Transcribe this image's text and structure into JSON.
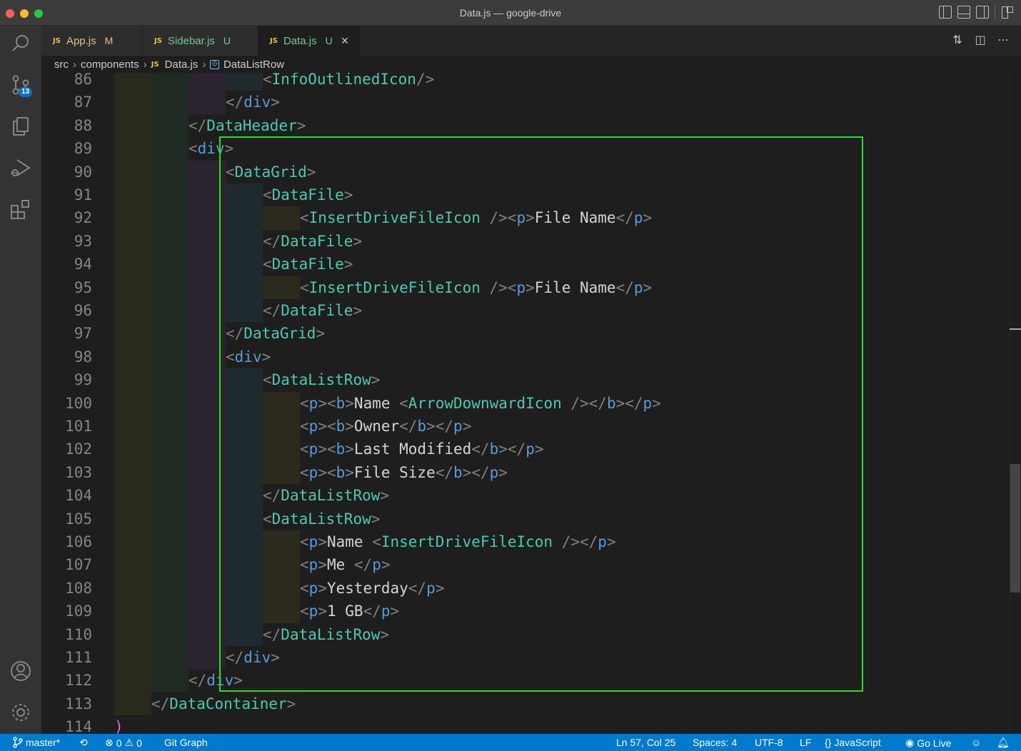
{
  "window": {
    "title": "Data.js — google-drive"
  },
  "activity_bar": {
    "items": [
      "search-icon",
      "source-control-icon",
      "explorer-icon",
      "run-debug-icon",
      "extensions-icon"
    ],
    "source_control_badge": "13",
    "bottom_items": [
      "accounts-icon",
      "settings-gear-icon"
    ]
  },
  "tabs": [
    {
      "lang": "JS",
      "label": "App.js",
      "status": "M"
    },
    {
      "lang": "JS",
      "label": "Sidebar.js",
      "status": "U"
    },
    {
      "lang": "JS",
      "label": "Data.js",
      "status": "U",
      "active": true
    }
  ],
  "tab_actions": [
    "compare-changes-icon",
    "split-editor-icon",
    "more-actions-icon"
  ],
  "breadcrumb": {
    "parts": [
      "src",
      "components"
    ],
    "file_lang": "JS",
    "file": "Data.js",
    "symbol": "DataListRow"
  },
  "editor": {
    "lines": [
      {
        "n": "86",
        "depth": 6,
        "tokens": [
          [
            "b",
            "<"
          ],
          [
            "tag",
            "InfoOutlinedIcon"
          ],
          [
            "b",
            "/>"
          ]
        ]
      },
      {
        "n": "87",
        "depth": 5,
        "tokens": [
          [
            "b",
            "</"
          ],
          [
            "html",
            "div"
          ],
          [
            "b",
            ">"
          ]
        ]
      },
      {
        "n": "88",
        "depth": 4,
        "tokens": [
          [
            "b",
            "</"
          ],
          [
            "tag",
            "DataHeader"
          ],
          [
            "b",
            ">"
          ]
        ]
      },
      {
        "n": "89",
        "depth": 4,
        "tokens": [
          [
            "b",
            "<"
          ],
          [
            "html",
            "div"
          ],
          [
            "b",
            ">"
          ]
        ]
      },
      {
        "n": "90",
        "depth": 5,
        "tokens": [
          [
            "b",
            "<"
          ],
          [
            "tag",
            "DataGrid"
          ],
          [
            "b",
            ">"
          ]
        ]
      },
      {
        "n": "91",
        "depth": 6,
        "tokens": [
          [
            "b",
            "<"
          ],
          [
            "tag",
            "DataFile"
          ],
          [
            "b",
            ">"
          ]
        ]
      },
      {
        "n": "92",
        "depth": 7,
        "tokens": [
          [
            "b",
            "<"
          ],
          [
            "tag",
            "InsertDriveFileIcon"
          ],
          [
            "b",
            " /><"
          ],
          [
            "html",
            "p"
          ],
          [
            "b",
            ">"
          ],
          [
            "txt",
            "File Name"
          ],
          [
            "b",
            "</"
          ],
          [
            "html",
            "p"
          ],
          [
            "b",
            ">"
          ]
        ]
      },
      {
        "n": "93",
        "depth": 6,
        "tokens": [
          [
            "b",
            "</"
          ],
          [
            "tag",
            "DataFile"
          ],
          [
            "b",
            ">"
          ]
        ]
      },
      {
        "n": "94",
        "depth": 6,
        "tokens": [
          [
            "b",
            "<"
          ],
          [
            "tag",
            "DataFile"
          ],
          [
            "b",
            ">"
          ]
        ]
      },
      {
        "n": "95",
        "depth": 7,
        "tokens": [
          [
            "b",
            "<"
          ],
          [
            "tag",
            "InsertDriveFileIcon"
          ],
          [
            "b",
            " /><"
          ],
          [
            "html",
            "p"
          ],
          [
            "b",
            ">"
          ],
          [
            "txt",
            "File Name"
          ],
          [
            "b",
            "</"
          ],
          [
            "html",
            "p"
          ],
          [
            "b",
            ">"
          ]
        ]
      },
      {
        "n": "96",
        "depth": 6,
        "tokens": [
          [
            "b",
            "</"
          ],
          [
            "tag",
            "DataFile"
          ],
          [
            "b",
            ">"
          ]
        ]
      },
      {
        "n": "97",
        "depth": 5,
        "tokens": [
          [
            "b",
            "</"
          ],
          [
            "tag",
            "DataGrid"
          ],
          [
            "b",
            ">"
          ]
        ]
      },
      {
        "n": "98",
        "depth": 5,
        "tokens": [
          [
            "b",
            "<"
          ],
          [
            "html",
            "div"
          ],
          [
            "b",
            ">"
          ]
        ]
      },
      {
        "n": "99",
        "depth": 6,
        "tokens": [
          [
            "b",
            "<"
          ],
          [
            "tag",
            "DataListRow"
          ],
          [
            "b",
            ">"
          ]
        ]
      },
      {
        "n": "100",
        "depth": 7,
        "tokens": [
          [
            "b",
            "<"
          ],
          [
            "html",
            "p"
          ],
          [
            "b",
            "><"
          ],
          [
            "html",
            "b"
          ],
          [
            "b",
            ">"
          ],
          [
            "txt",
            "Name "
          ],
          [
            "b",
            "<"
          ],
          [
            "tag",
            "ArrowDownwardIcon"
          ],
          [
            "b",
            " /></"
          ],
          [
            "html",
            "b"
          ],
          [
            "b",
            "></"
          ],
          [
            "html",
            "p"
          ],
          [
            "b",
            ">"
          ]
        ]
      },
      {
        "n": "101",
        "depth": 7,
        "tokens": [
          [
            "b",
            "<"
          ],
          [
            "html",
            "p"
          ],
          [
            "b",
            "><"
          ],
          [
            "html",
            "b"
          ],
          [
            "b",
            ">"
          ],
          [
            "txt",
            "Owner"
          ],
          [
            "b",
            "</"
          ],
          [
            "html",
            "b"
          ],
          [
            "b",
            "></"
          ],
          [
            "html",
            "p"
          ],
          [
            "b",
            ">"
          ]
        ]
      },
      {
        "n": "102",
        "depth": 7,
        "tokens": [
          [
            "b",
            "<"
          ],
          [
            "html",
            "p"
          ],
          [
            "b",
            "><"
          ],
          [
            "html",
            "b"
          ],
          [
            "b",
            ">"
          ],
          [
            "txt",
            "Last Modified"
          ],
          [
            "b",
            "</"
          ],
          [
            "html",
            "b"
          ],
          [
            "b",
            "></"
          ],
          [
            "html",
            "p"
          ],
          [
            "b",
            ">"
          ]
        ]
      },
      {
        "n": "103",
        "depth": 7,
        "tokens": [
          [
            "b",
            "<"
          ],
          [
            "html",
            "p"
          ],
          [
            "b",
            "><"
          ],
          [
            "html",
            "b"
          ],
          [
            "b",
            ">"
          ],
          [
            "txt",
            "File Size"
          ],
          [
            "b",
            "</"
          ],
          [
            "html",
            "b"
          ],
          [
            "b",
            "></"
          ],
          [
            "html",
            "p"
          ],
          [
            "b",
            ">"
          ]
        ]
      },
      {
        "n": "104",
        "depth": 6,
        "tokens": [
          [
            "b",
            "</"
          ],
          [
            "tag",
            "DataListRow"
          ],
          [
            "b",
            ">"
          ]
        ]
      },
      {
        "n": "105",
        "depth": 6,
        "tokens": [
          [
            "b",
            "<"
          ],
          [
            "tag",
            "DataListRow"
          ],
          [
            "b",
            ">"
          ]
        ]
      },
      {
        "n": "106",
        "depth": 7,
        "tokens": [
          [
            "b",
            "<"
          ],
          [
            "html",
            "p"
          ],
          [
            "b",
            ">"
          ],
          [
            "txt",
            "Name "
          ],
          [
            "b",
            "<"
          ],
          [
            "tag",
            "InsertDriveFileIcon"
          ],
          [
            "b",
            " /></"
          ],
          [
            "html",
            "p"
          ],
          [
            "b",
            ">"
          ]
        ]
      },
      {
        "n": "107",
        "depth": 7,
        "tokens": [
          [
            "b",
            "<"
          ],
          [
            "html",
            "p"
          ],
          [
            "b",
            ">"
          ],
          [
            "txt",
            "Me "
          ],
          [
            "b",
            "</"
          ],
          [
            "html",
            "p"
          ],
          [
            "b",
            ">"
          ]
        ]
      },
      {
        "n": "108",
        "depth": 7,
        "tokens": [
          [
            "b",
            "<"
          ],
          [
            "html",
            "p"
          ],
          [
            "b",
            ">"
          ],
          [
            "txt",
            "Yesterday"
          ],
          [
            "b",
            "</"
          ],
          [
            "html",
            "p"
          ],
          [
            "b",
            ">"
          ]
        ]
      },
      {
        "n": "109",
        "depth": 7,
        "tokens": [
          [
            "b",
            "<"
          ],
          [
            "html",
            "p"
          ],
          [
            "b",
            ">"
          ],
          [
            "txt",
            "1 GB"
          ],
          [
            "b",
            "</"
          ],
          [
            "html",
            "p"
          ],
          [
            "b",
            ">"
          ]
        ]
      },
      {
        "n": "110",
        "depth": 6,
        "tokens": [
          [
            "b",
            "</"
          ],
          [
            "tag",
            "DataListRow"
          ],
          [
            "b",
            ">"
          ]
        ]
      },
      {
        "n": "111",
        "depth": 5,
        "tokens": [
          [
            "b",
            "</"
          ],
          [
            "html",
            "div"
          ],
          [
            "b",
            ">"
          ]
        ]
      },
      {
        "n": "112",
        "depth": 4,
        "tokens": [
          [
            "b",
            "</"
          ],
          [
            "html",
            "div"
          ],
          [
            "b",
            ">"
          ]
        ]
      },
      {
        "n": "113",
        "depth": 3,
        "tokens": [
          [
            "b",
            "</"
          ],
          [
            "tag",
            "DataContainer"
          ],
          [
            "b",
            ">"
          ]
        ]
      },
      {
        "n": "114",
        "depth": 2,
        "tokens": [
          [
            "paren",
            ")"
          ]
        ]
      }
    ],
    "highlight_color": "#1ee31e"
  },
  "status_bar": {
    "branch": "master*",
    "sync_icon": "sync-icon",
    "errors": "0",
    "warnings": "0",
    "git_graph": "Git Graph",
    "cursor": "Ln 57, Col 25",
    "spaces": "Spaces: 4",
    "encoding": "UTF-8",
    "eol": "LF",
    "language": "JavaScript",
    "go_live": "Go Live"
  },
  "colors": {
    "statusbar": "#007acc",
    "tag": "#4ec9b0",
    "html_tag": "#569cd6",
    "bracket": "#808080"
  }
}
